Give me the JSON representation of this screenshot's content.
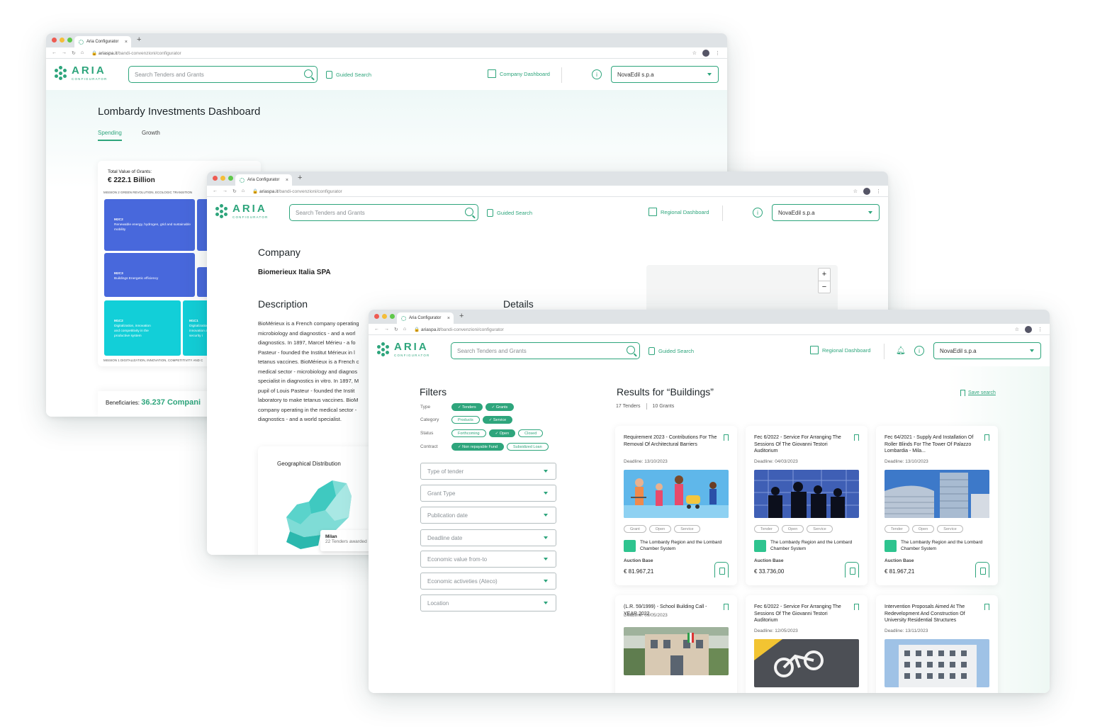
{
  "browser": {
    "tab_title": "Aria Configurator",
    "url_host": "ariaspa.it",
    "url_path": "/bandi-convenzioni/configurator"
  },
  "logo": {
    "word": "ARIA",
    "sub": "CONFIGURATOR"
  },
  "header": {
    "search_placeholder": "Search Tenders and Grants",
    "guided_search": "Guided Search",
    "company_dashboard": "Company Dashboard",
    "regional_dashboard": "Regional Dashboard",
    "company_select": "NovaEdil s.p.a",
    "info": "i"
  },
  "window1": {
    "title": "Lombardy Investments Dashboard",
    "tabs": [
      {
        "label": "Spending",
        "active": true
      },
      {
        "label": "Growth",
        "active": false
      }
    ],
    "total_label": "Total Value of Grants:",
    "total_value": "€ 222.1 Billion",
    "mission2": "MISSION 2 GREEN REVOLUTION, ECOLOGIC TRANSITION",
    "mission1": "MISSION 1 DIGITALIZATION, INNOVATION, COMPETITIVITY AND C",
    "tiles": [
      {
        "code": "M2C2",
        "text": "Renewable energy, hydrogen, grid and sustainable mobility"
      },
      {
        "code": "M2C3",
        "text": "Buildings Energetic efficiency"
      },
      {
        "code": "M1C2",
        "text": "Digitalization, innovation and competitivity in the productive system"
      },
      {
        "code": "M1C1",
        "text": "Digitalization, innovation and security i"
      }
    ],
    "beneficiaries_label": "Beneficiaries:",
    "beneficiaries_value": "36.237 Compani"
  },
  "window2": {
    "company_heading": "Company",
    "company_name": "Biomerieux Italia SPA",
    "description_heading": "Description",
    "details_heading": "Details",
    "description_lines": [
      "BioMérieux is a French company operating",
      "microbiology and diagnostics - and a worl",
      "diagnostics. In 1897, Marcel Mérieu - a fo",
      "Pasteur - founded the Institut Mérieux in l",
      "tetanus vaccines. BioMérieux is a French c",
      "medical sector - microbiology and diagnos",
      "specialist in diagnostics in vitro. In 1897, M",
      "pupil of Louis Pasteur - founded the Instit",
      "laboratory to make tetanus vaccines. BioM",
      "company operating in the medical sector -",
      "diagnostics - and a world specialist."
    ],
    "zoom_in": "+",
    "zoom_out": "−",
    "geo_title": "Geographical Distribution",
    "tooltip_city": "Milan",
    "tooltip_value": "22 Tenders awarded"
  },
  "window3": {
    "filters_title": "Filters",
    "filter_rows": [
      {
        "label": "Type",
        "chips": [
          {
            "text": "✓ Tenders",
            "on": true
          },
          {
            "text": "✓ Grants",
            "on": true
          }
        ]
      },
      {
        "label": "Category",
        "chips": [
          {
            "text": "Products",
            "on": false
          },
          {
            "text": "✓ Service",
            "on": true
          }
        ]
      },
      {
        "label": "Status",
        "chips": [
          {
            "text": "Forthcoming",
            "on": false
          },
          {
            "text": "✓ Open",
            "on": true
          },
          {
            "text": "Closed",
            "on": false
          }
        ]
      },
      {
        "label": "Contract",
        "chips": [
          {
            "text": "✓ Non repayable Fund",
            "on": true
          },
          {
            "text": "Subsidized Loan",
            "on": false
          }
        ]
      }
    ],
    "selects": [
      "Type of tender",
      "Grant Type",
      "Publication date",
      "Deadline date",
      "Economic value from-to",
      "Economic activeties (Ateco)",
      "Location"
    ],
    "results_title": "Results for “Buildings”",
    "tenders_count": "17 Tenders",
    "grants_count": "10 Grants",
    "save_search": "Save search",
    "cards": [
      {
        "title": "Requirement 2023 - Contributions For The Removal Of Architectural Barriers",
        "deadline": "Deadline: 13/10/2023",
        "img": "family",
        "tags": [
          "Grant",
          "Open",
          "Service"
        ],
        "org": "The Lombardy Region and the Lombard Chamber System",
        "auction_label": "Auction Base",
        "auction_value": "€ 81.967,21"
      },
      {
        "title": "Fec 6/2022 - Service For Arranging The Sessions Of The Giovanni Testori Auditorium",
        "deadline": "Deadline: 04/03/2023",
        "img": "workers",
        "tags": [
          "Tender",
          "Open",
          "Service"
        ],
        "org": "The Lombardy Region and the Lombard Chamber System",
        "auction_label": "Auction Base",
        "auction_value": "€ 33.736,00"
      },
      {
        "title": "Fec 64/2021 - Supply And Installation Of Roller Blinds For The Tower Of Palazzo Lombardia - Mila...",
        "deadline": "Deadline: 13/10/2023",
        "img": "tower",
        "tags": [
          "Tender",
          "Open",
          "Service"
        ],
        "org": "The Lombardy Region and the Lombard Chamber System",
        "auction_label": "Auction Base",
        "auction_value": "€ 81.967,21"
      },
      {
        "title": "(L.R. 59/1999) - School Building Call - YEAR 2022",
        "deadline": "Deadline: 09/05/2023",
        "img": "school"
      },
      {
        "title": "Fec 6/2022 - Service For Arranging The Sessions Of The Giovanni Testori Auditorium",
        "deadline": "Deadline: 12/05/2023",
        "img": "bike"
      },
      {
        "title": "Intervention Proposals Aimed At The Redevelopment And Construction Of University Residential Structures",
        "deadline": "Deadline: 13/11/2023",
        "img": "residence"
      }
    ]
  },
  "colors": {
    "brand": "#2ea57c",
    "tile_blue": "#4868dc",
    "tile_cyan": "#12cfd8"
  }
}
